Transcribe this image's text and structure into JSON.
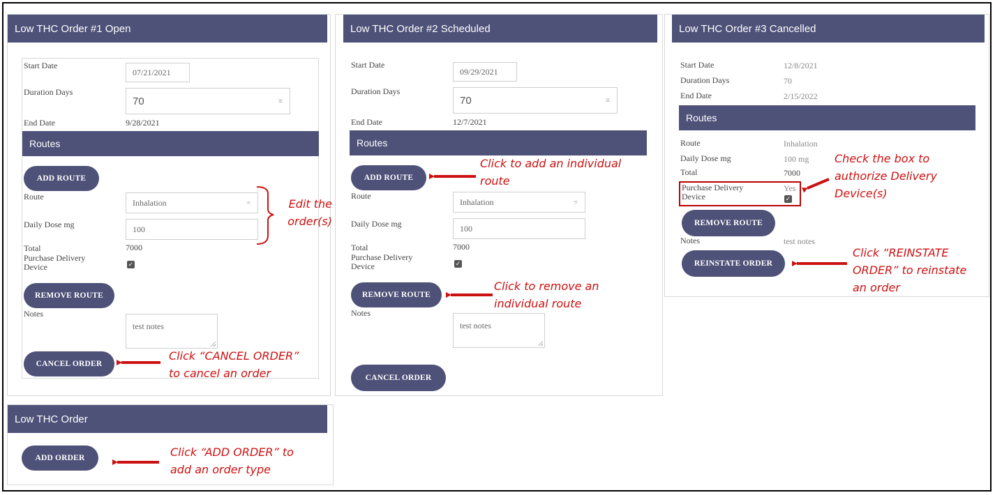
{
  "orders": [
    {
      "title": "Low THC Order #1 Open",
      "start_label": "Start Date",
      "start_value": "07/21/2021",
      "duration_label": "Duration Days",
      "duration_value": "70",
      "end_label": "End Date",
      "end_value": "9/28/2021",
      "routes_label": "Routes",
      "add_route": "ADD ROUTE",
      "route_label": "Route",
      "route_value": "Inhalation",
      "dose_label": "Daily Dose mg",
      "dose_value": "100",
      "total_label": "Total",
      "total_value": "7000",
      "purchase_label": "Purchase Delivery Device",
      "remove_route": "REMOVE ROUTE",
      "notes_label": "Notes",
      "notes_value": "test notes",
      "cancel_order": "CANCEL ORDER"
    },
    {
      "title": "Low THC Order #2 Scheduled",
      "start_label": "Start Date",
      "start_value": "09/29/2021",
      "duration_label": "Duration Days",
      "duration_value": "70",
      "end_label": "End Date",
      "end_value": "12/7/2021",
      "routes_label": "Routes",
      "add_route": "ADD ROUTE",
      "route_label": "Route",
      "route_value": "Inhalation",
      "dose_label": "Daily Dose mg",
      "dose_value": "100",
      "total_label": "Total",
      "total_value": "7000",
      "purchase_label": "Purchase Delivery Device",
      "remove_route": "REMOVE ROUTE",
      "notes_label": "Notes",
      "notes_value": "test notes",
      "cancel_order": "CANCEL ORDER"
    },
    {
      "title": "Low THC Order #3 Cancelled",
      "start_label": "Start Date",
      "start_value": "12/8/2021",
      "duration_label": "Duration Days",
      "duration_value": "70",
      "end_label": "End Date",
      "end_value": "2/15/2022",
      "routes_label": "Routes",
      "route_label": "Route",
      "route_value": "Inhalation",
      "dose_label": "Daily Dose mg",
      "dose_value": "100 mg",
      "total_label": "Total",
      "total_value": "7000",
      "purchase_label": "Purchase Delivery Device",
      "purchase_value": "Yes",
      "remove_route": "REMOVE ROUTE",
      "notes_label": "Notes",
      "notes_value": "test notes",
      "reinstate_order": "REINSTATE ORDER"
    }
  ],
  "new_order": {
    "title": "Low THC Order",
    "add_order": "ADD ORDER"
  },
  "annotations": {
    "edit_line1": "Edit the",
    "edit_line2": "order(s)",
    "add_route_line1": "Click to add an individual",
    "add_route_line2": "route",
    "remove_route_line1": "Click to remove an",
    "remove_route_line2": "individual route",
    "cancel_line1": "Click “CANCEL ORDER”",
    "cancel_line2": "to cancel an order",
    "check_line1": "Check the box to",
    "check_line2": "authorize Delivery",
    "check_line3": "Device(s)",
    "reinstate_line1": "Click “REINSTATE",
    "reinstate_line2": "ORDER” to reinstate",
    "reinstate_line3": "an order",
    "add_order_line1": "Click “ADD ORDER” to",
    "add_order_line2": "add an order type"
  },
  "colors": {
    "header": "#4e5178",
    "annotation": "#cc1111"
  },
  "icons": {
    "checkbox": "checkbox-checked-icon",
    "spinner": "number-spinner-icon",
    "arrow": "red-arrow-icon"
  }
}
